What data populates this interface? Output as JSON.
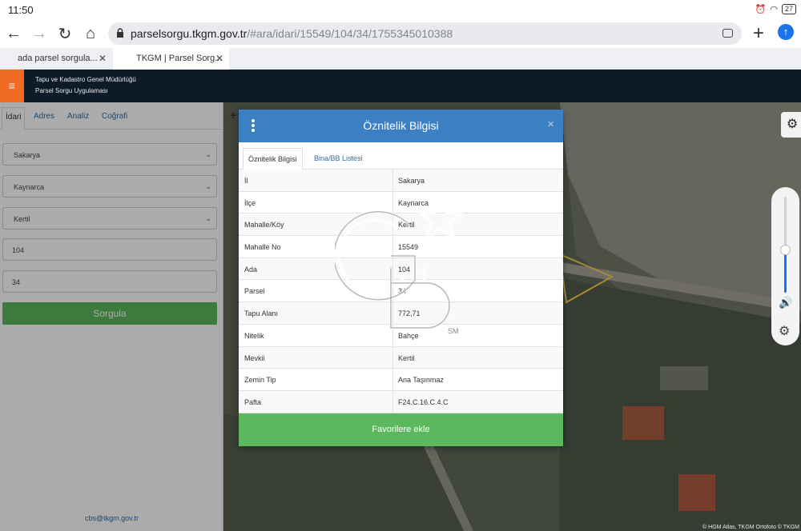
{
  "status": {
    "time": "11:50",
    "battery": "27"
  },
  "browser": {
    "url_host": "parselsorgu.tkgm.gov.tr",
    "url_path": "/#ara/idari/15549/104/34/1755345010388",
    "tabs": [
      {
        "title": "ada parsel sorgula..."
      },
      {
        "title": "TKGM | Parsel Sorg..."
      }
    ]
  },
  "app": {
    "title_line1": "Tapu ve Kadastro Genel Müdürlüğü",
    "title_line2": "Parsel Sorgu Uygulaması"
  },
  "sidebar": {
    "tabs": [
      "İdari",
      "Adres",
      "Analiz",
      "Coğrafi"
    ],
    "il": "Sakarya",
    "ilce": "Kaynarca",
    "mahalle": "Kertil",
    "ada": "104",
    "parsel": "34",
    "button": "Sorgula",
    "email": "cbs@tkgm.gov.tr"
  },
  "modal": {
    "title": "Öznitelik Bilgisi",
    "close": "×",
    "tabs": [
      "Öznitelik Bilgisi",
      "Bina/BB Listesi"
    ],
    "rows": [
      {
        "k": "İl",
        "v": "Sakarya"
      },
      {
        "k": "İlçe",
        "v": "Kaynarca"
      },
      {
        "k": "Mahalle/Köy",
        "v": "Kertil"
      },
      {
        "k": "Mahalle No",
        "v": "15549"
      },
      {
        "k": "Ada",
        "v": "104"
      },
      {
        "k": "Parsel",
        "v": "34"
      },
      {
        "k": "Tapu Alanı",
        "v": "772,71"
      },
      {
        "k": "Nitelik",
        "v": "Bahçe"
      },
      {
        "k": "Mevkii",
        "v": "Kertil"
      },
      {
        "k": "Zemin Tip",
        "v": "Ana Taşınmaz"
      },
      {
        "k": "Pafta",
        "v": "F24.C.16.C.4.C"
      }
    ],
    "favorite_button": "Favorilere ekle"
  },
  "map": {
    "attribution": "© HGM Atlas, TKGM Ortofoto © TKGM"
  },
  "volume": {
    "level_percent": 45
  },
  "colors": {
    "header": "#3b80c3",
    "green": "#5cb85c",
    "orange": "#ef6c22",
    "navy": "#0d1b29"
  }
}
